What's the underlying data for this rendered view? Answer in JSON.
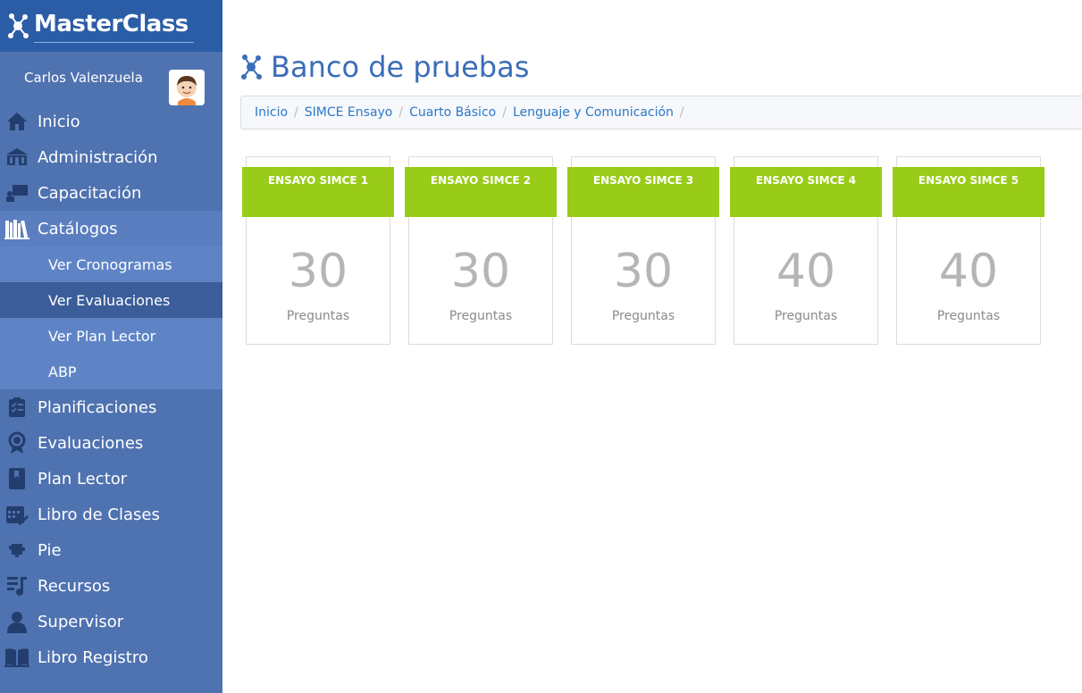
{
  "app": {
    "logo_text": "MasterClass"
  },
  "user": {
    "name": "Carlos Valenzuela"
  },
  "menu": [
    {
      "label": "Inicio",
      "icon": "home-icon"
    },
    {
      "label": "Administración",
      "icon": "building-icon"
    },
    {
      "label": "Capacitación",
      "icon": "presentation-icon"
    },
    {
      "label": "Catálogos",
      "icon": "books-icon"
    },
    {
      "label": "Planificaciones",
      "icon": "clipboard-icon"
    },
    {
      "label": "Evaluaciones",
      "icon": "medal-icon"
    },
    {
      "label": "Plan Lector",
      "icon": "book-icon"
    },
    {
      "label": "Libro de Clases",
      "icon": "calendar-edit-icon"
    },
    {
      "label": "Pie",
      "icon": "puzzle-icon"
    },
    {
      "label": "Recursos",
      "icon": "music-list-icon"
    },
    {
      "label": "Supervisor",
      "icon": "person-icon"
    },
    {
      "label": "Libro Registro",
      "icon": "open-book-icon"
    }
  ],
  "submenu": [
    {
      "label": "Ver Cronogramas"
    },
    {
      "label": "Ver Evaluaciones"
    },
    {
      "label": "Ver Plan Lector"
    },
    {
      "label": "ABP"
    }
  ],
  "page": {
    "title": "Banco de pruebas"
  },
  "breadcrumb": [
    "Inicio",
    "SIMCE Ensayo",
    "Cuarto Básico",
    "Lenguaje y Comunicación"
  ],
  "cards": [
    {
      "title": "ENSAYO SIMCE 1",
      "count": "30",
      "label": "Preguntas"
    },
    {
      "title": "ENSAYO SIMCE 2",
      "count": "30",
      "label": "Preguntas"
    },
    {
      "title": "ENSAYO SIMCE 3",
      "count": "30",
      "label": "Preguntas"
    },
    {
      "title": "ENSAYO SIMCE 4",
      "count": "40",
      "label": "Preguntas"
    },
    {
      "title": "ENSAYO SIMCE 5",
      "count": "40",
      "label": "Preguntas"
    }
  ],
  "colors": {
    "sidebar": "#4f72b0",
    "logo_bar": "#2b5da6",
    "accent": "#99cc18",
    "title": "#3b6db8"
  }
}
